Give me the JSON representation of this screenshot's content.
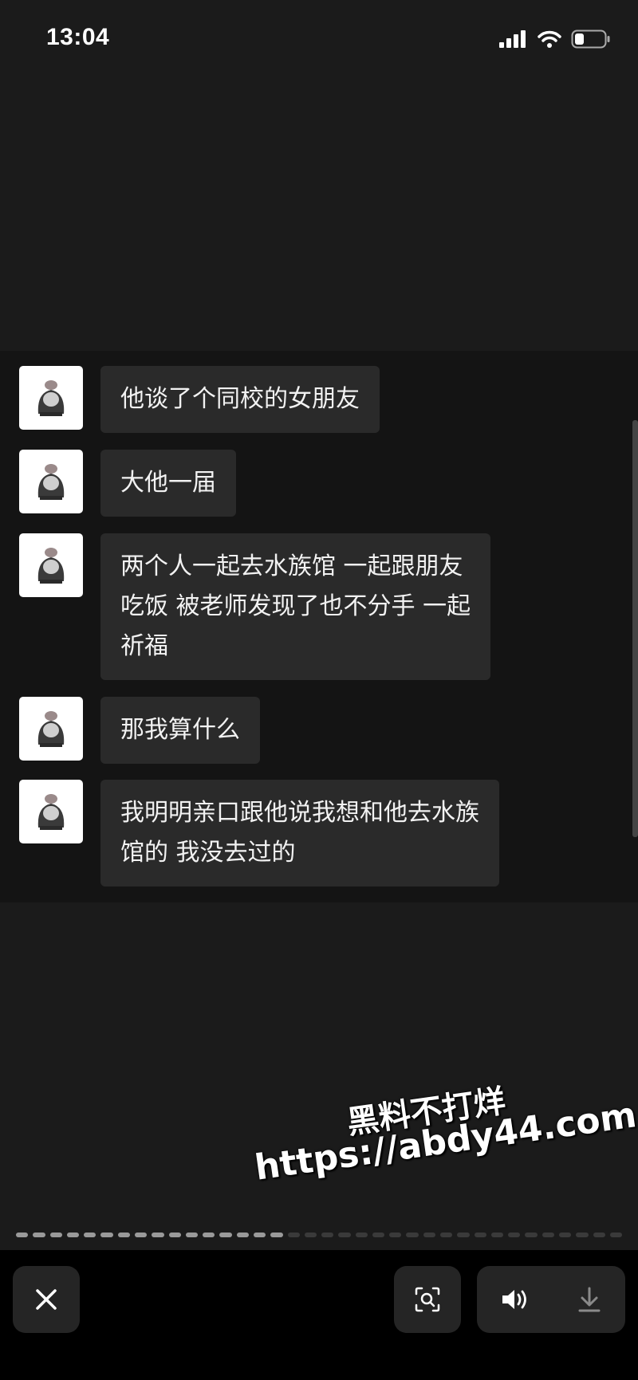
{
  "status_bar": {
    "time": "13:04",
    "icons": [
      "cellular-signal-icon",
      "wifi-icon",
      "battery-icon"
    ]
  },
  "messages": [
    {
      "lines": [
        "他谈了个同校的女朋友"
      ]
    },
    {
      "lines": [
        "大他一届"
      ]
    },
    {
      "lines": [
        "两个人一起去水族馆 一起跟朋友",
        "吃饭 被老师发现了也不分手 一起",
        "祈福"
      ]
    },
    {
      "lines": [
        "那我算什么"
      ]
    },
    {
      "lines": [
        "我明明亲口跟他说我想和他去水族",
        "馆的 我没去过的"
      ]
    }
  ],
  "watermark": {
    "line1": "黑料不打烊",
    "line2": "https://abdy44.com"
  },
  "progress": {
    "segments": 36,
    "completed": 16
  },
  "controls": {
    "close": "close-icon",
    "lens": "visual-lookup-icon",
    "volume": "speaker-icon",
    "download": "download-icon"
  },
  "colors": {
    "background": "#1b1b1b",
    "chat_panel": "#141414",
    "bubble": "#2a2a2a"
  }
}
